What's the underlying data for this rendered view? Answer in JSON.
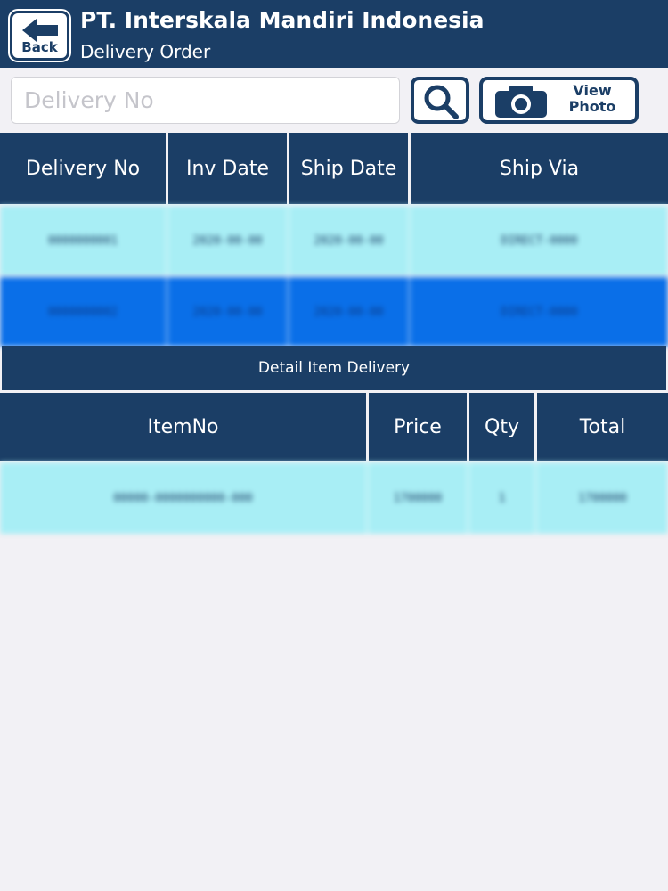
{
  "header": {
    "back_label": "Back",
    "company_name": "PT. Interskala Mandiri Indonesia",
    "screen_title": "Delivery Order"
  },
  "search": {
    "placeholder": "Delivery No",
    "value": "",
    "view_photo_label": "View\nPhoto"
  },
  "delivery_table": {
    "columns": [
      "Delivery No",
      "Inv Date",
      "Ship Date",
      "Ship Via"
    ],
    "rows": [
      {
        "delivery_no": "0000000001",
        "inv_date": "2020-00-00",
        "ship_date": "2020-00-00",
        "ship_via": "DIRECT-0000"
      },
      {
        "delivery_no": "0000000002",
        "inv_date": "2020-00-00",
        "ship_date": "2020-00-00",
        "ship_via": "DIRECT-0000"
      }
    ]
  },
  "detail": {
    "title": "Detail Item Delivery",
    "columns": [
      "ItemNo",
      "Price",
      "Qty",
      "Total"
    ],
    "rows": [
      {
        "item_no": "00000-0000000000-000",
        "price": "1700000",
        "qty": "1",
        "total": "1700000"
      }
    ]
  },
  "colors": {
    "primary": "#1b3e66",
    "row_light": "#a8eef5",
    "row_selected": "#0a6fe8",
    "background": "#f2f1f5"
  },
  "icons": [
    "back-arrow-icon",
    "search-icon",
    "camera-icon"
  ]
}
